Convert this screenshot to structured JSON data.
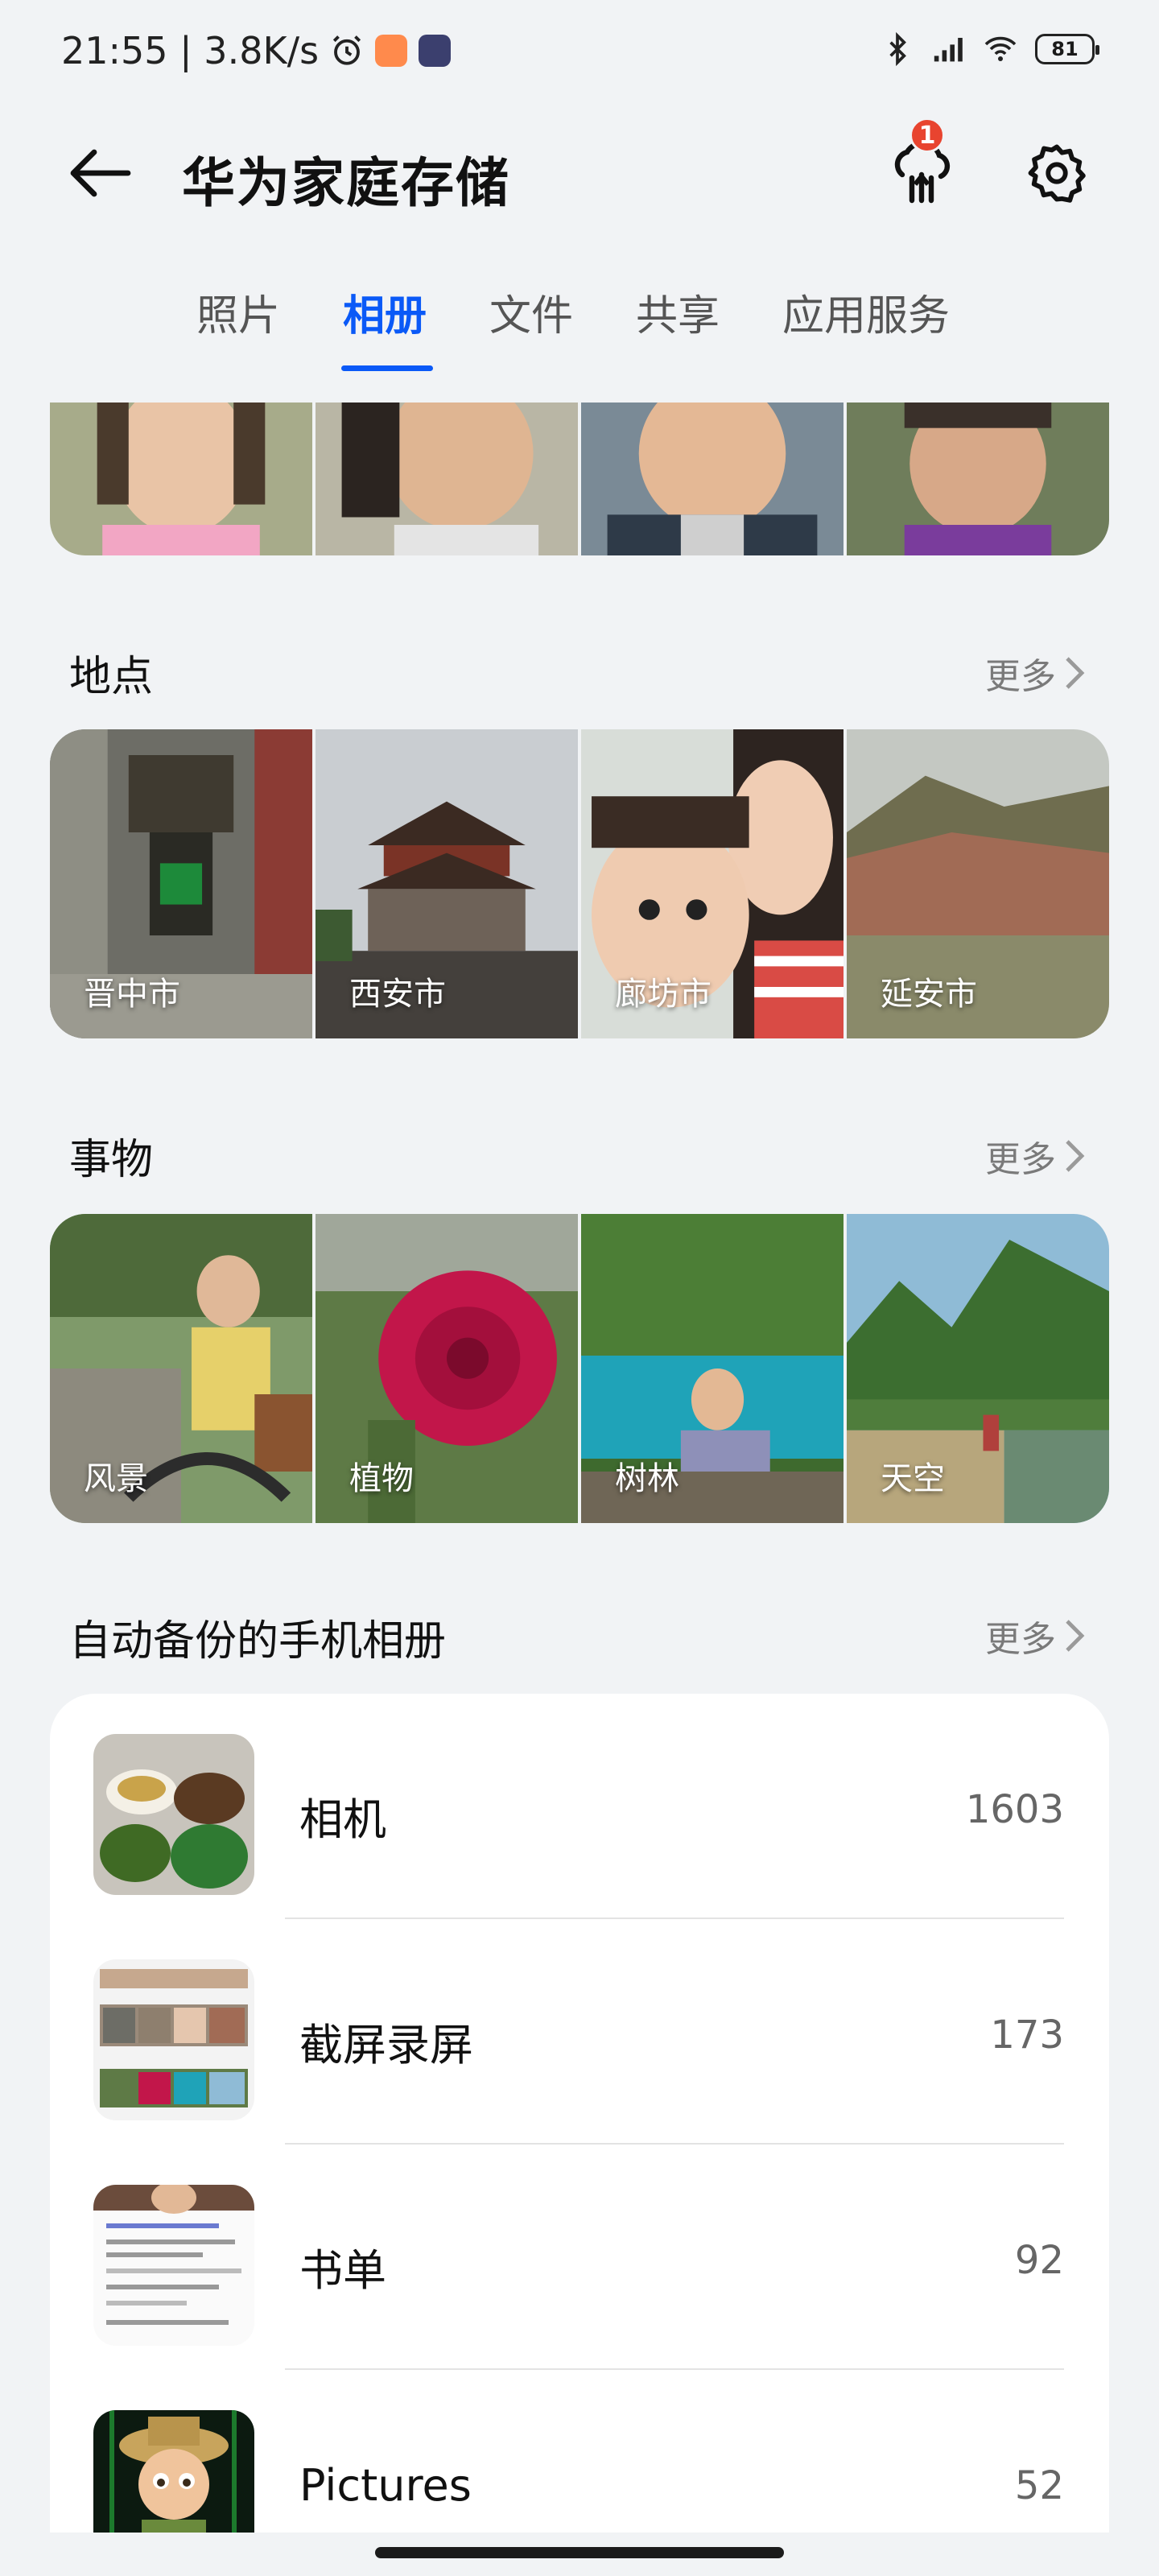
{
  "status_bar": {
    "time_speed": "21:55 | 3.8K/s",
    "battery": "81",
    "icons": [
      "alarm-icon",
      "app-icon",
      "app-icon",
      "bluetooth-icon",
      "signal-icon",
      "wifi-icon",
      "battery-icon"
    ]
  },
  "header": {
    "title": "华为家庭存储",
    "upload_badge": "1"
  },
  "tabs": [
    {
      "label": "照片"
    },
    {
      "label": "相册"
    },
    {
      "label": "文件"
    },
    {
      "label": "共享"
    },
    {
      "label": "应用服务"
    }
  ],
  "active_tab": "相册",
  "places": {
    "title": "地点",
    "more": "更多",
    "items": [
      {
        "label": "晋中市"
      },
      {
        "label": "西安市"
      },
      {
        "label": "廊坊市"
      },
      {
        "label": "延安市"
      }
    ]
  },
  "things": {
    "title": "事物",
    "more": "更多",
    "items": [
      {
        "label": "风景"
      },
      {
        "label": "植物"
      },
      {
        "label": "树林"
      },
      {
        "label": "天空"
      }
    ]
  },
  "auto_backup": {
    "title": "自动备份的手机相册",
    "more": "更多",
    "albums": [
      {
        "name": "相机",
        "count": "1603"
      },
      {
        "name": "截屏录屏",
        "count": "173"
      },
      {
        "name": "书单",
        "count": "92"
      },
      {
        "name": "Pictures",
        "count": "52"
      }
    ]
  },
  "colors": {
    "accent": "#0a59f7",
    "badge": "#e8442f",
    "background": "#f1f3f5"
  }
}
